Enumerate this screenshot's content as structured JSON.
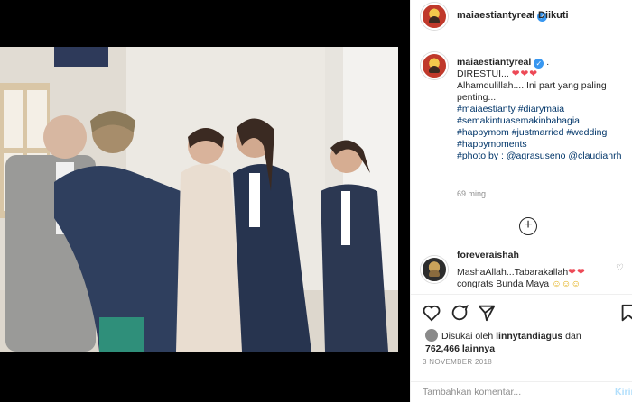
{
  "post": {
    "username": "maiaestiantyreal",
    "header_dot": "•",
    "follow_label": "Diikuti",
    "caption": {
      "username": "maiaestiantyreal",
      "suffix": ".",
      "line1": "DIRESTUI...",
      "hearts": "❤❤❤",
      "line2": "Alhamdulillah.... Ini part yang paling penting...",
      "tags1": "#maiaestianty #diarymaia #semakintuasemakinbahagia #happymom #justmarried #wedding #happymoments",
      "photo_by": "#photo by : @agrasuseno @claudianrh"
    },
    "caption_time": "69 ming",
    "more_comments": "+",
    "comment2": {
      "username": "foreveraishah",
      "text": "MashaAllah...Tabarakallah",
      "hearts": "❤❤",
      "text2": "congrats Bunda Maya",
      "emojis": "☺☺☺"
    },
    "likes": {
      "prefix": "Disukai oleh",
      "by_user": "linnytandiagus",
      "connector": "dan",
      "count": "762,466",
      "suffix": "lainnya"
    },
    "date": "3 NOVEMBER 2018",
    "add_comment_placeholder": "Tambahkan komentar...",
    "post_label": "Kirim"
  },
  "colors": {
    "link": "#003569",
    "verified": "#3897f0",
    "heart": "#ed4956",
    "muted": "#8e8e8e"
  },
  "icons": [
    "heart-icon",
    "comment-icon",
    "share-icon",
    "bookmark-icon",
    "verified-icon",
    "plus-circle-icon"
  ]
}
